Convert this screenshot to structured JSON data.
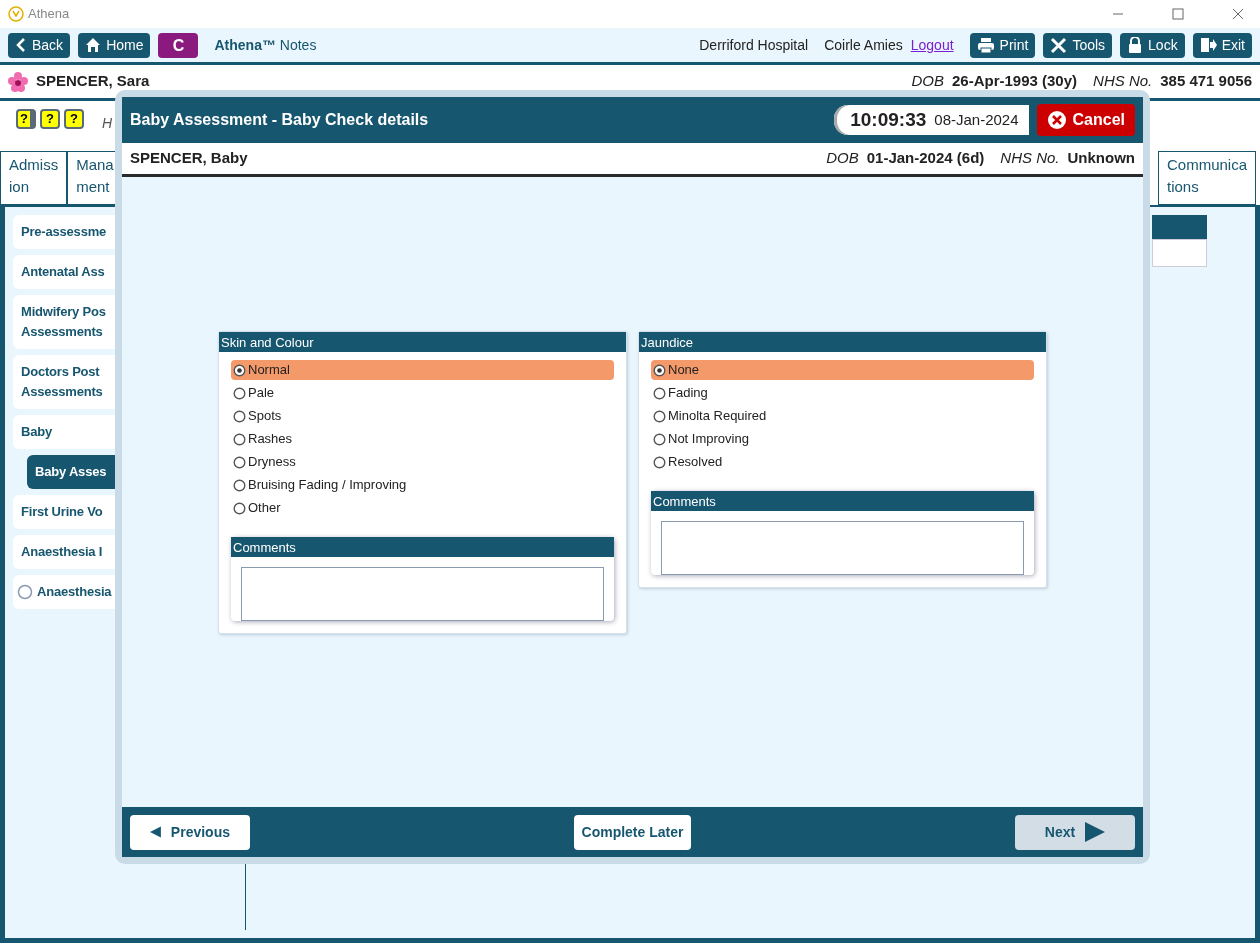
{
  "window": {
    "title": "Athena"
  },
  "toolbar": {
    "buttons_left": [
      {
        "label": "Back"
      },
      {
        "label": "Home"
      }
    ],
    "c_button": "C",
    "app_name": "Athena™",
    "app_section": "Notes",
    "hospital": "Derriford Hospital",
    "user": "Coirle Amies",
    "logout": "Logout",
    "buttons_right": [
      {
        "label": "Print"
      },
      {
        "label": "Tools"
      },
      {
        "label": "Lock"
      },
      {
        "label": "Exit"
      }
    ]
  },
  "patient": {
    "name": "SPENCER, Sara",
    "dob_label": "DOB",
    "dob": "26-Apr-1993 (30y)",
    "nhs_label": "NHS No.",
    "nhs": "385 471 9056"
  },
  "help_icons": [
    "?",
    "?",
    "?"
  ],
  "hint_text": "H",
  "tabs": [
    {
      "lines": [
        "Admiss",
        "ion"
      ]
    },
    {
      "lines": [
        "Mana",
        "ment"
      ]
    },
    {
      "lines": [
        "Communica",
        "tions"
      ]
    }
  ],
  "menu": [
    {
      "kind": "link",
      "lines": [
        "Pre-assessme"
      ],
      "selected": false
    },
    {
      "kind": "link",
      "lines": [
        "Antenatal Ass"
      ],
      "selected": false
    },
    {
      "kind": "link",
      "lines": [
        "Midwifery Pos",
        "Assessments"
      ],
      "selected": false
    },
    {
      "kind": "link",
      "lines": [
        "Doctors Post",
        "Assessments"
      ],
      "selected": false
    },
    {
      "kind": "link",
      "lines": [
        "Baby"
      ],
      "selected": false,
      "children": [
        {
          "kind": "link",
          "lines": [
            "Baby Asses"
          ],
          "selected": true
        }
      ]
    },
    {
      "kind": "link",
      "lines": [
        "First Urine Vo"
      ],
      "selected": false
    },
    {
      "kind": "link",
      "lines": [
        "Anaesthesia I"
      ],
      "selected": false
    },
    {
      "kind": "radio",
      "lines": [
        "Anaesthesia"
      ],
      "selected": false
    }
  ],
  "modal": {
    "title": "Baby Assessment - Baby Check details",
    "time": "10:09:33",
    "date": "08-Jan-2024",
    "cancel": "Cancel",
    "baby": {
      "name": "SPENCER, Baby",
      "dob_label": "DOB",
      "dob": "01-Jan-2024 (6d)",
      "nhs_label": "NHS No.",
      "nhs": "Unknown"
    },
    "panels": [
      {
        "title": "Skin and Colour",
        "comments_title": "Comments",
        "options": [
          {
            "label": "Normal",
            "selected": true
          },
          {
            "label": "Pale",
            "selected": false
          },
          {
            "label": "Spots",
            "selected": false
          },
          {
            "label": "Rashes",
            "selected": false
          },
          {
            "label": "Dryness",
            "selected": false
          },
          {
            "label": "Bruising Fading / Improving",
            "selected": false
          },
          {
            "label": "Other",
            "selected": false
          }
        ]
      },
      {
        "title": "Jaundice",
        "comments_title": "Comments",
        "options": [
          {
            "label": "None",
            "selected": true
          },
          {
            "label": "Fading",
            "selected": false
          },
          {
            "label": "Minolta Required",
            "selected": false
          },
          {
            "label": "Not Improving",
            "selected": false
          },
          {
            "label": "Resolved",
            "selected": false
          }
        ]
      }
    ],
    "footer": {
      "previous": {
        "label": "Previous",
        "disabled": false
      },
      "complete_later": {
        "label": "Complete Later",
        "disabled": false
      },
      "next": {
        "label": "Next",
        "disabled": true
      }
    }
  }
}
